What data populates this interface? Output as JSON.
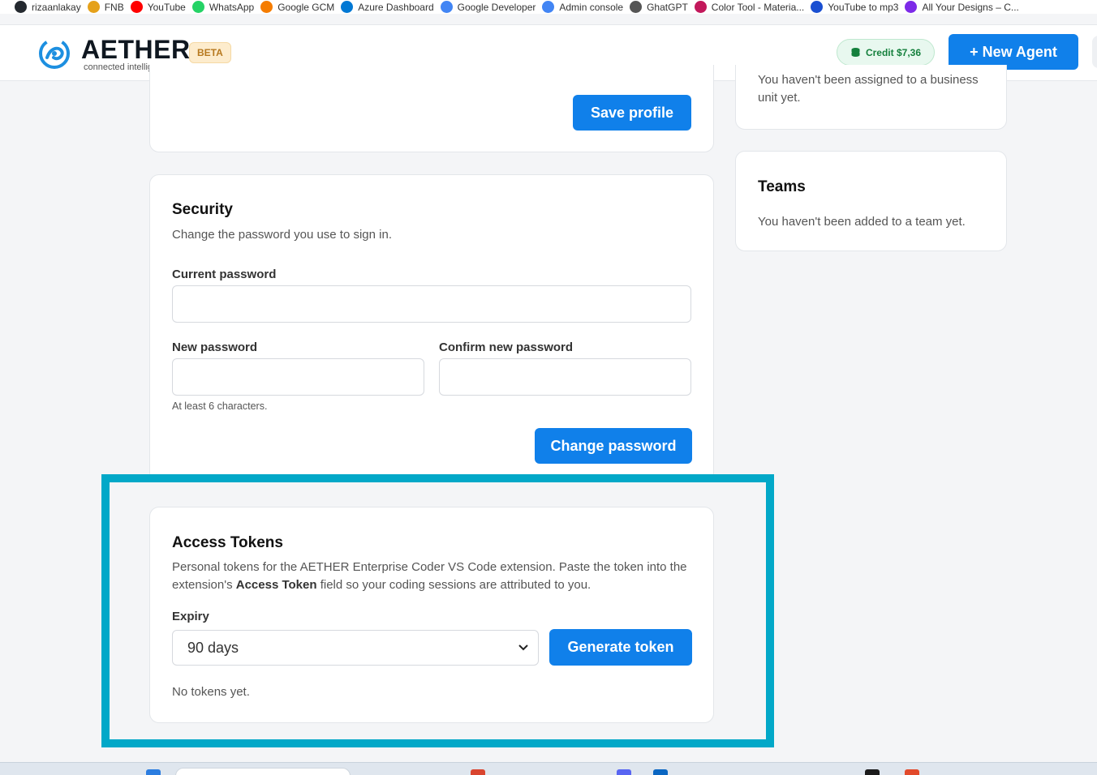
{
  "bookmarks": [
    {
      "label": "rizaanlakay",
      "color": "#24292f"
    },
    {
      "label": "FNB",
      "color": "#e5a11a"
    },
    {
      "label": "YouTube",
      "color": "#ff0000"
    },
    {
      "label": "WhatsApp",
      "color": "#25d366"
    },
    {
      "label": "Google GCM",
      "color": "#f57c00"
    },
    {
      "label": "Azure Dashboard",
      "color": "#0078d4"
    },
    {
      "label": "Google Developer",
      "color": "#4285f4"
    },
    {
      "label": "Admin console",
      "color": "#4285f4"
    },
    {
      "label": "GhatGPT",
      "color": "#555555"
    },
    {
      "label": "Color Tool - Materia...",
      "color": "#c2185b"
    },
    {
      "label": "YouTube to mp3",
      "color": "#1a4fd1"
    },
    {
      "label": "All Your Designs – C...",
      "color": "#7d2ae8"
    }
  ],
  "header": {
    "brand": "AETHER",
    "tagline": "connected intelligence...",
    "beta": "BETA",
    "credit": "Credit $7,36",
    "new_agent": "+ New Agent"
  },
  "profile": {
    "save_label": "Save profile"
  },
  "business_unit": {
    "text": "You haven't been assigned to a business unit yet."
  },
  "teams": {
    "title": "Teams",
    "text": "You haven't been added to a team yet."
  },
  "security": {
    "title": "Security",
    "subtitle": "Change the password you use to sign in.",
    "current_label": "Current password",
    "new_label": "New password",
    "confirm_label": "Confirm new password",
    "hint": "At least 6 characters.",
    "change_label": "Change password"
  },
  "tokens": {
    "title": "Access Tokens",
    "desc_before": "Personal tokens for the AETHER Enterprise Coder VS Code extension. Paste the token into the extension's ",
    "desc_bold": "Access Token",
    "desc_after": " field so your coding sessions are attributed to you.",
    "expiry_label": "Expiry",
    "expiry_value": "90 days",
    "generate_label": "Generate token",
    "empty_text": "No tokens yet."
  },
  "colors": {
    "primary": "#1080ea",
    "highlight": "#02a8c8",
    "credit_bg": "#e8f8ef",
    "beta_bg": "#fdeccd"
  }
}
